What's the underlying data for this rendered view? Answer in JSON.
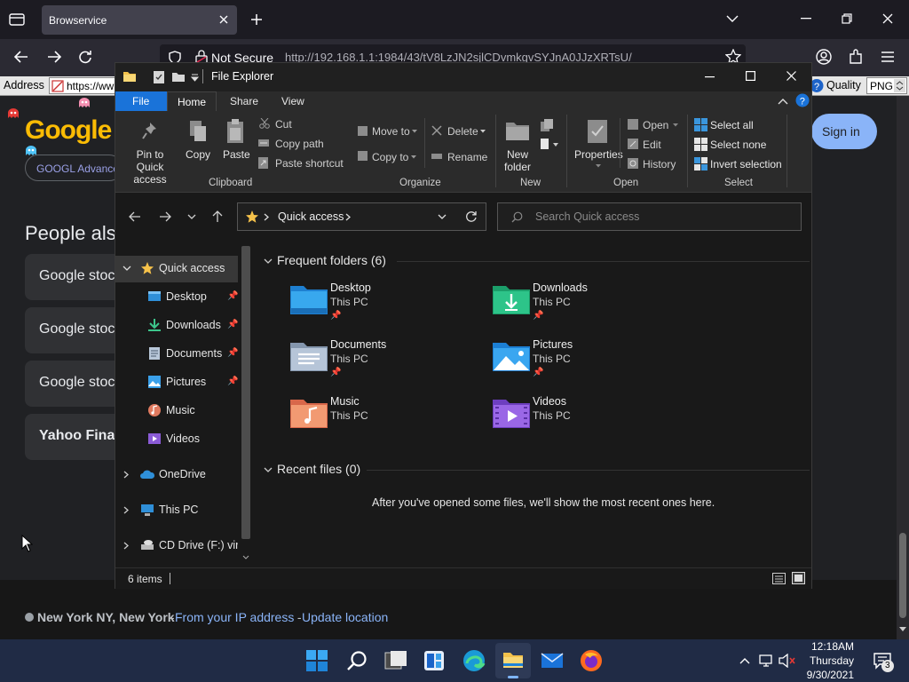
{
  "browser": {
    "tab_title": "Browservice",
    "not_secure": "Not Secure",
    "url": "http://192.168.1.1:1984/43/tV8LzJN2sjlCDvmkgvSYJnA0JJzXRTsU/",
    "address_label": "Address",
    "address_value": "https://ww",
    "quality_label": "Quality",
    "quality_value": "PNG"
  },
  "google": {
    "logo": "Google",
    "advanced": "GOOGL Advance",
    "sign_in": "Sign in",
    "people_also": "People also",
    "cards": [
      "Google stoc",
      "Google stoc",
      "Google stoc",
      "Yahoo Fina"
    ],
    "location": "New York NY, New York",
    "from_ip": "From your IP address",
    "separator": " - ",
    "update_location": "Update location"
  },
  "explorer": {
    "title": "File Explorer",
    "tabs": [
      "File",
      "Home",
      "Share",
      "View"
    ],
    "ribbon": {
      "pin": "Pin to Quick\naccess",
      "copy": "Copy",
      "paste": "Paste",
      "cut": "Cut",
      "copy_path": "Copy path",
      "paste_shortcut": "Paste shortcut",
      "clipboard": "Clipboard",
      "move_to": "Move to",
      "copy_to": "Copy to",
      "delete": "Delete",
      "rename": "Rename",
      "organize": "Organize",
      "new_folder": "New\nfolder",
      "new_group": "New",
      "properties": "Properties",
      "open": "Open",
      "edit": "Edit",
      "history": "History",
      "open_group": "Open",
      "select_all": "Select all",
      "select_none": "Select none",
      "invert_selection": "Invert selection",
      "select_group": "Select"
    },
    "address": "Quick access",
    "search_placeholder": "Search Quick access",
    "tree": [
      {
        "label": "Quick access"
      },
      {
        "label": "Desktop"
      },
      {
        "label": "Downloads"
      },
      {
        "label": "Documents"
      },
      {
        "label": "Pictures"
      },
      {
        "label": "Music"
      },
      {
        "label": "Videos"
      },
      {
        "label": "OneDrive"
      },
      {
        "label": "This PC"
      },
      {
        "label": "CD Drive (F:) virti"
      }
    ],
    "frequent_header": "Frequent folders (6)",
    "folders": [
      {
        "name": "Desktop",
        "location": "This PC"
      },
      {
        "name": "Downloads",
        "location": "This PC"
      },
      {
        "name": "Documents",
        "location": "This PC"
      },
      {
        "name": "Pictures",
        "location": "This PC"
      },
      {
        "name": "Music",
        "location": "This PC"
      },
      {
        "name": "Videos",
        "location": "This PC"
      }
    ],
    "recent_header": "Recent files (0)",
    "recent_empty": "After you've opened some files, we'll show the most recent ones here.",
    "status": "6 items"
  },
  "taskbar": {
    "time": "12:18AM",
    "day": "Thursday",
    "date": "9/30/2021",
    "notification_count": "3"
  }
}
